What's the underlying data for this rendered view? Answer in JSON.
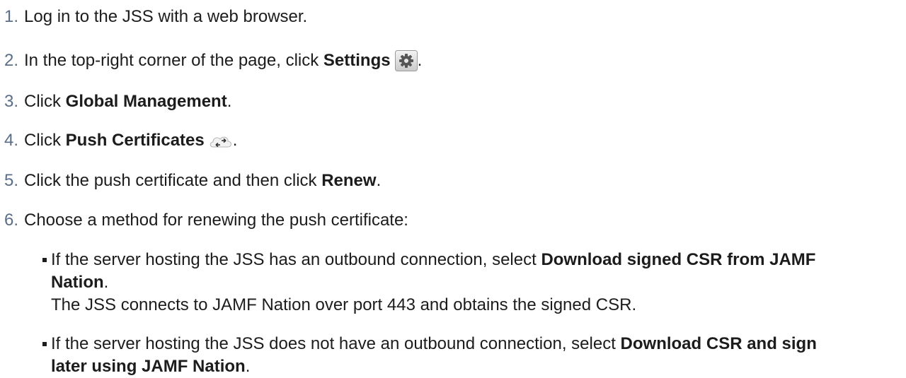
{
  "steps": [
    {
      "num": "1.",
      "parts": [
        "Log in to the JSS with a web browser."
      ]
    },
    {
      "num": "2.",
      "pre": "In the top-right corner of the page, click ",
      "bold": "Settings",
      "post": "."
    },
    {
      "num": "3.",
      "pre": "Click ",
      "bold": "Global Management",
      "post": "."
    },
    {
      "num": "4.",
      "pre": "Click ",
      "bold": "Push Certificates",
      "post": "."
    },
    {
      "num": "5.",
      "pre": "Click the push certificate and then click ",
      "bold": "Renew",
      "post": "."
    },
    {
      "num": "6.",
      "text": "Choose a method for renewing the push certificate:"
    }
  ],
  "sub_items": [
    {
      "pre": "If the server hosting the JSS has an outbound connection, select ",
      "bold1": "Download signed CSR from JAMF",
      "bold2": "Nation",
      "post": ".",
      "note": "The JSS connects to JAMF Nation over port 443 and obtains the signed CSR."
    },
    {
      "pre": "If the server hosting the JSS does not have an outbound connection, select ",
      "bold1": "Download CSR and sign",
      "bold2": "later using JAMF Nation",
      "post": "."
    }
  ],
  "icons": {
    "settings": "gear-icon",
    "push_certificates": "cloud-arrows-icon"
  },
  "colors": {
    "step_number": "#5a6e87",
    "text": "#1c1c1c"
  }
}
